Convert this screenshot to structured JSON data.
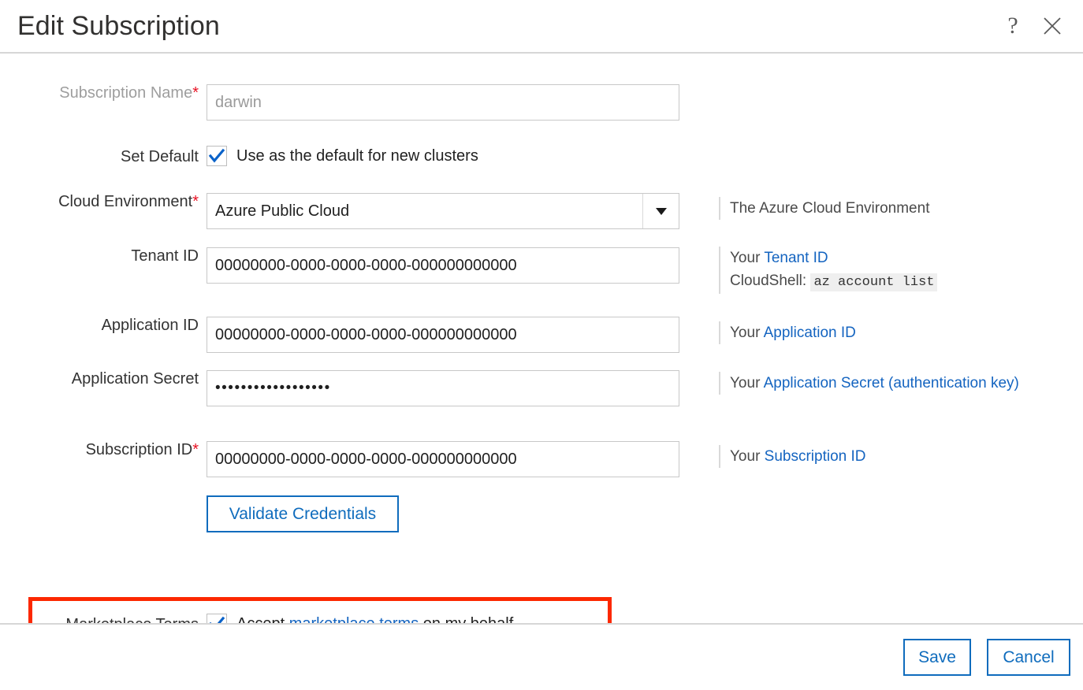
{
  "dialog": {
    "title": "Edit Subscription",
    "help_icon_label": "?",
    "close_icon_label": "✕"
  },
  "form": {
    "subscription_name": {
      "label": "Subscription Name",
      "required_marker": "*",
      "value": "darwin"
    },
    "set_default": {
      "label": "Set Default",
      "checkbox_label": "Use as the default for new clusters",
      "checked": true
    },
    "cloud_environment": {
      "label": "Cloud Environment",
      "required_marker": "*",
      "selected": "Azure Public Cloud",
      "help": "The Azure Cloud Environment"
    },
    "tenant_id": {
      "label": "Tenant ID",
      "value": "00000000-0000-0000-0000-000000000000",
      "help_prefix": "Your ",
      "help_link": "Tenant ID",
      "help_line2_prefix": "CloudShell: ",
      "help_code": "az account list"
    },
    "application_id": {
      "label": "Application ID",
      "value": "00000000-0000-0000-0000-000000000000",
      "help_prefix": "Your ",
      "help_link": "Application ID"
    },
    "application_secret": {
      "label": "Application Secret",
      "value": "••••••••••••••••••",
      "help_prefix": "Your ",
      "help_link": "Application Secret (authentication key)"
    },
    "subscription_id": {
      "label": "Subscription ID",
      "required_marker": "*",
      "value": "00000000-0000-0000-0000-000000000000",
      "help_prefix": "Your ",
      "help_link": "Subscription ID"
    },
    "validate_button": "Validate Credentials",
    "marketplace_terms": {
      "label": "Marketplace Terms",
      "checked": true,
      "text_before": "Accept ",
      "link": "marketplace terms",
      "text_after": " on my behalf"
    }
  },
  "footer": {
    "save_label": "Save",
    "cancel_label": "Cancel"
  },
  "colors": {
    "accent_blue": "#0f6cbd",
    "link_blue": "#1464c0",
    "required_red": "#e81123",
    "highlight_red": "#fc2800",
    "checkbox_check": "#0a62c9",
    "divider_gray": "#d6d6d6",
    "label_muted": "#9e9e9e"
  }
}
